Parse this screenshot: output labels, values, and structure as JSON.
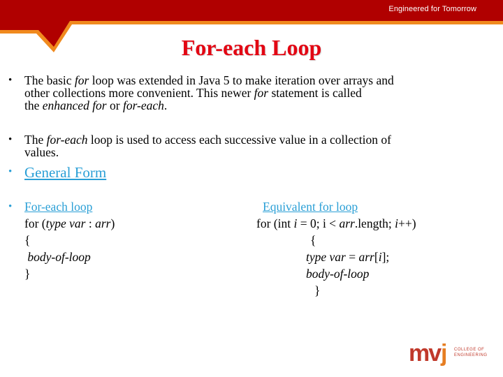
{
  "header": {
    "tagline": "Engineered for Tomorrow",
    "colors": {
      "band": "#b00000",
      "stripe": "#f08a1e"
    }
  },
  "slide": {
    "title": "For-each Loop",
    "bullets": [
      {
        "lines": [
          [
            {
              "t": "The basic "
            },
            {
              "t": "for",
              "i": true
            },
            {
              "t": " loop was extended in Java 5 to make iteration over arrays and"
            }
          ],
          [
            {
              "t": "other collections more convenient. This newer "
            },
            {
              "t": "for",
              "i": true
            },
            {
              "t": " statement is called"
            }
          ],
          [
            {
              "t": "the "
            },
            {
              "t": "enhanced for",
              "i": true
            },
            {
              "t": " or "
            },
            {
              "t": "for-each",
              "i": true
            },
            {
              "t": "."
            }
          ]
        ]
      },
      {
        "lines": [
          [
            {
              "t": "The "
            },
            {
              "t": "for-each",
              "i": true
            },
            {
              "t": " loop is used to access each successive value in a collection of"
            }
          ],
          [
            {
              "t": "values."
            }
          ]
        ]
      }
    ],
    "general_form": "General Form",
    "foreach_heading": "For-each loop",
    "foreach_code": [
      "for (|type var| : |arr|)",
      "{",
      " |body-of-loop|",
      "}"
    ],
    "equivalent_heading": "Equivalent for loop",
    "equivalent_code": [
      "for (int |i| = 0; i < |arr|.length; |i|++)",
      "{",
      "|type var| = |arr|[|i|];",
      "|body-of-loop|",
      "}"
    ],
    "link_color": "#2a9fd6",
    "title_color": "#e30613"
  },
  "logo": {
    "mark_left": "mv",
    "mark_right": "j",
    "line1": "COLLEGE OF",
    "line2": "ENGINEERING"
  }
}
